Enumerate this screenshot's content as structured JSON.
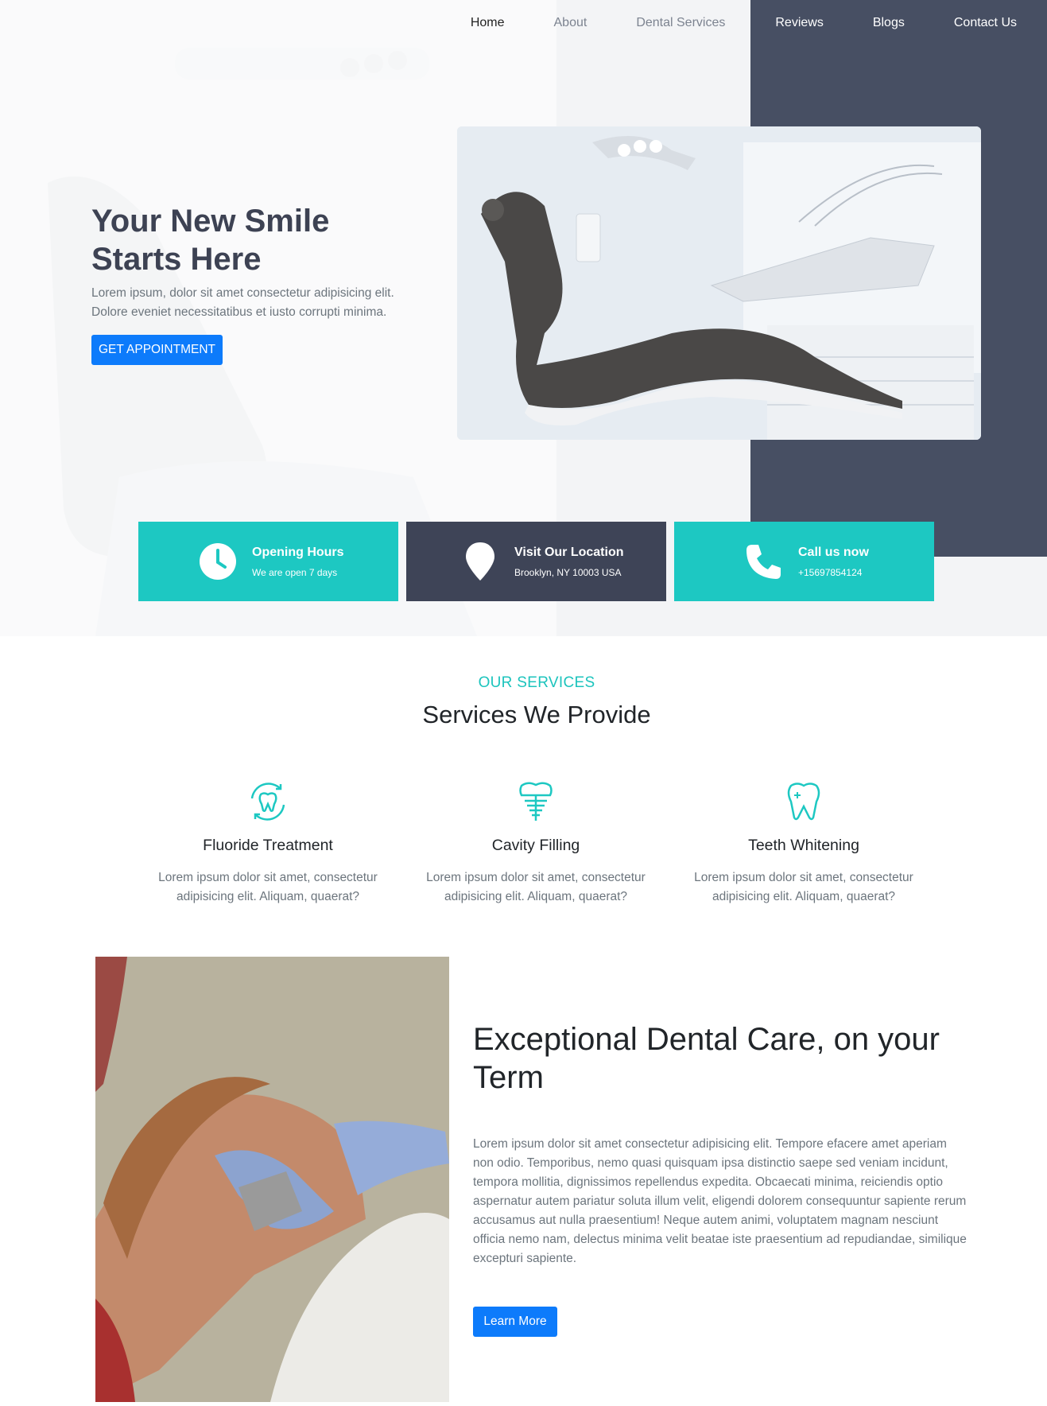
{
  "nav": {
    "items": [
      {
        "label": "Home"
      },
      {
        "label": "About"
      },
      {
        "label": "Dental Services"
      },
      {
        "label": "Reviews"
      },
      {
        "label": "Blogs"
      },
      {
        "label": "Contact Us"
      }
    ]
  },
  "hero": {
    "title": "Your New Smile Starts Here",
    "subtitle": "Lorem ipsum, dolor sit amet consectetur adipisicing elit. Dolore eveniet necessitatibus et iusto corrupti minima.",
    "button": "GET APPOINTMENT"
  },
  "info": [
    {
      "title": "Opening Hours",
      "text": "We are open 7 days",
      "icon": "clock-icon"
    },
    {
      "title": "Visit Our Location",
      "text": "Brooklyn, NY 10003 USA",
      "icon": "map-pin-icon"
    },
    {
      "title": "Call us now",
      "text": "+15697854124",
      "icon": "phone-icon"
    }
  ],
  "services": {
    "kicker": "OUR SERVICES",
    "title": "Services We Provide",
    "items": [
      {
        "title": "Fluoride Treatment",
        "text": "Lorem ipsum dolor sit amet, consectetur adipisicing elit. Aliquam, quaerat?",
        "icon": "tooth-refresh-icon"
      },
      {
        "title": "Cavity Filling",
        "text": "Lorem ipsum dolor sit amet, consectetur adipisicing elit. Aliquam, quaerat?",
        "icon": "dental-implant-icon"
      },
      {
        "title": "Teeth Whitening",
        "text": "Lorem ipsum dolor sit amet, consectetur adipisicing elit. Aliquam, quaerat?",
        "icon": "tooth-sparkle-icon"
      }
    ]
  },
  "care": {
    "title": "Exceptional Dental Care, on your Term",
    "text": "Lorem ipsum dolor sit amet consectetur adipisicing elit. Tempore efacere amet aperiam non odio. Temporibus, nemo quasi quisquam ipsa distinctio saepe sed veniam incidunt, tempora mollitia, dignissimos repellendus expedita. Obcaecati minima, reiciendis optio aspernatur autem pariatur soluta illum velit, eligendi dolorem consequuntur sapiente rerum accusamus aut nulla praesentium! Neque autem animi, voluptatem magnam nesciunt officia nemo nam, delectus minima velit beatae iste praesentium ad repudiandae, similique excepturi sapiente.",
    "button": "Learn More"
  },
  "colors": {
    "teal": "#1dc8c2",
    "navy": "#3e4457",
    "dark_panel": "#474f63",
    "primary_blue": "#0d7bfb"
  }
}
